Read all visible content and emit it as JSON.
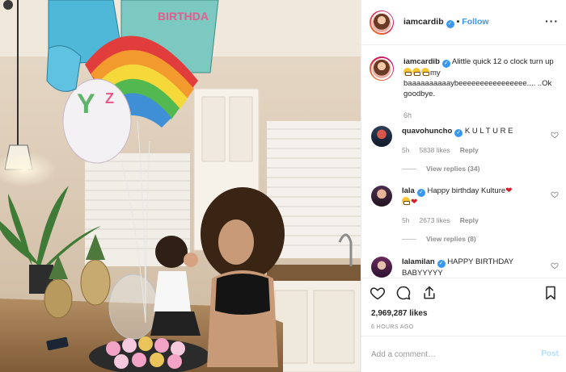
{
  "header": {
    "username": "iamcardib",
    "separator": "•",
    "follow_label": "Follow",
    "more_label": "···"
  },
  "caption": {
    "username": "iamcardib",
    "text_before": "Alittle quick 12 o clock turn up",
    "text_after": "my baaaaaaaaaaybeeeeeeeeeeeeeeee.... ..Ok goodbye.",
    "emoji_count": 3,
    "time": "6h"
  },
  "comments": [
    {
      "username": "quavohuncho",
      "text": "K U L T U R E",
      "time": "5h",
      "likes": "5838 likes",
      "reply_label": "Reply",
      "view_replies": "View replies (34)"
    },
    {
      "username": "lala",
      "text": "Happy birthday Kulture",
      "emoji": "❤",
      "time": "5h",
      "likes": "2673 likes",
      "reply_label": "Reply",
      "view_replies": "View replies (8)"
    },
    {
      "username": "lalamilan",
      "text": "HAPPY BIRTHDAY BABYYYYY"
    }
  ],
  "actions": {
    "likes_count": "2,969,287 likes",
    "time_ago": "6 HOURS AGO"
  },
  "composer": {
    "placeholder": "Add a comment…",
    "post_label": "Post"
  },
  "colors": {
    "accent": "#3897f0",
    "text": "#262626",
    "muted": "#8e8e8e",
    "border": "#efefef",
    "heart_red": "#d81e2c"
  }
}
